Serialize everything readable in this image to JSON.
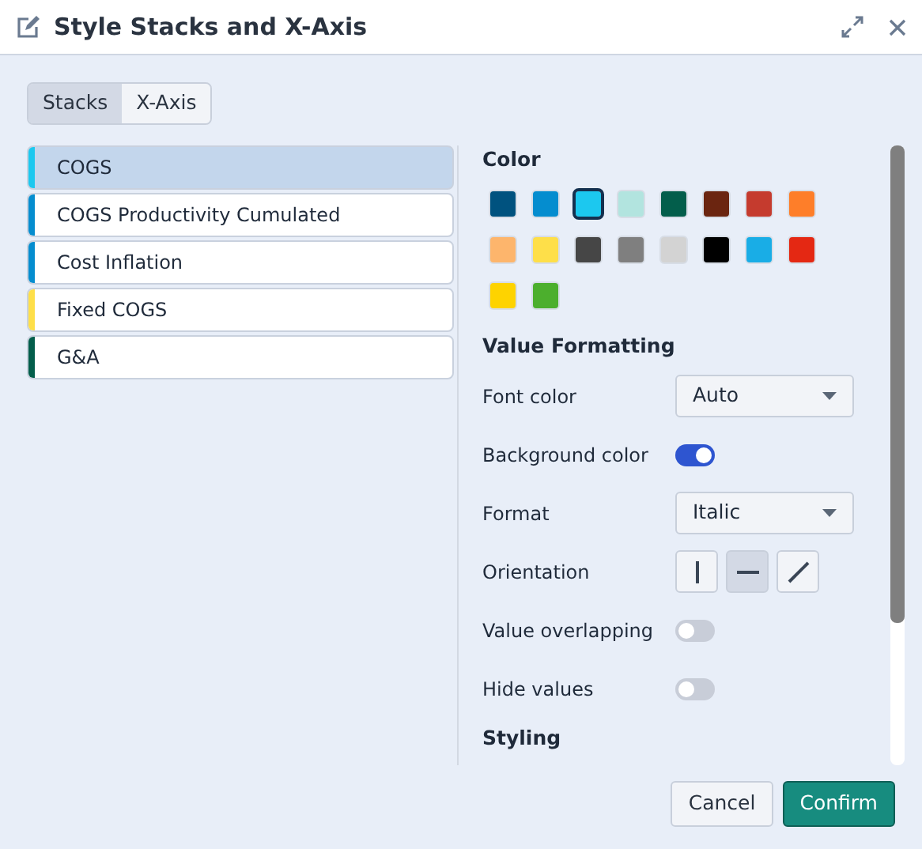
{
  "window": {
    "title": "Style Stacks and X-Axis"
  },
  "tabs": [
    {
      "label": "Stacks",
      "selected": true
    },
    {
      "label": "X-Axis",
      "selected": false
    }
  ],
  "stacks": [
    {
      "label": "COGS",
      "color": "#1cc8ef",
      "selected": true
    },
    {
      "label": "COGS Productivity Cumulated",
      "color": "#058dcf",
      "selected": false
    },
    {
      "label": "Cost Inflation",
      "color": "#058dcf",
      "selected": false
    },
    {
      "label": "Fixed COGS",
      "color": "#fedf49",
      "selected": false
    },
    {
      "label": "G&A",
      "color": "#035e4b",
      "selected": false
    }
  ],
  "color_section": {
    "heading": "Color",
    "swatches": [
      {
        "color": "#00527f",
        "selected": false
      },
      {
        "color": "#058dcf",
        "selected": false
      },
      {
        "color": "#1cc8ef",
        "selected": true
      },
      {
        "color": "#b2e4df",
        "selected": false
      },
      {
        "color": "#035e4b",
        "selected": false
      },
      {
        "color": "#6b2510",
        "selected": false
      },
      {
        "color": "#c53b2e",
        "selected": false
      },
      {
        "color": "#fe7e29",
        "selected": false
      },
      {
        "color": "#fdb56c",
        "selected": false
      },
      {
        "color": "#fedf49",
        "selected": false
      },
      {
        "color": "#464646",
        "selected": false
      },
      {
        "color": "#7f7f7f",
        "selected": false
      },
      {
        "color": "#d3d3d3",
        "selected": false
      },
      {
        "color": "#000000",
        "selected": false
      },
      {
        "color": "#19ade6",
        "selected": false
      },
      {
        "color": "#e42813",
        "selected": false
      },
      {
        "color": "#fed300",
        "selected": false
      },
      {
        "color": "#4caf2d",
        "selected": false
      }
    ]
  },
  "value_formatting": {
    "heading": "Value Formatting",
    "rows": [
      {
        "kind": "select",
        "label": "Font color",
        "value": "Auto"
      },
      {
        "kind": "toggle",
        "label": "Background color",
        "on": true
      },
      {
        "kind": "select",
        "label": "Format",
        "value": "Italic"
      },
      {
        "kind": "orientation",
        "label": "Orientation",
        "options": [
          {
            "kind": "vertical",
            "selected": false
          },
          {
            "kind": "horizontal",
            "selected": true
          },
          {
            "kind": "diagonal",
            "selected": false
          }
        ]
      },
      {
        "kind": "toggle",
        "label": "Value overlapping",
        "on": false
      },
      {
        "kind": "toggle",
        "label": "Hide values",
        "on": false
      }
    ]
  },
  "styling": {
    "heading": "Styling"
  },
  "buttons": [
    {
      "label": "Cancel",
      "kind": "secondary"
    },
    {
      "label": "Confirm",
      "kind": "primary"
    }
  ]
}
